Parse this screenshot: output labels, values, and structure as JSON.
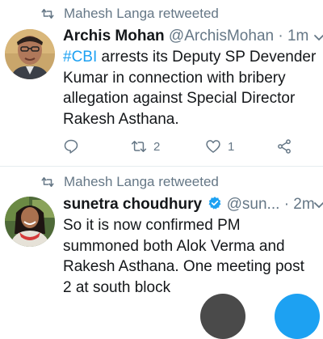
{
  "tweets": [
    {
      "retweeted_by": "Mahesh Langa retweeted",
      "name": "Archis Mohan",
      "handle": "@ArchisMohan",
      "separator": "·",
      "time": "1m",
      "hashtag": "#CBI",
      "text_rest": " arrests its Deputy SP Devender Kumar in connection with bribery allegation against Special Director Rakesh Asthana.",
      "retweets": "2",
      "likes": "1"
    },
    {
      "retweeted_by": "Mahesh Langa retweeted",
      "name": "sunetra choudhury",
      "handle": "@sun...",
      "separator": "·",
      "time": "2m",
      "text": "So it is now confirmed PM summoned both Alok Verma and Rakesh Asthana. One meeting post 2 at south block"
    }
  ],
  "icons": {
    "retweeted": "retweet-icon",
    "reply": "reply-icon",
    "retweet": "retweet-icon",
    "like": "heart-icon",
    "share": "share-icon",
    "verified": "verified-badge-icon",
    "menu": "chevron-down-icon"
  },
  "colors": {
    "accent": "#1da1f2",
    "secondary_text": "#657786",
    "primary_text": "#14171a"
  }
}
